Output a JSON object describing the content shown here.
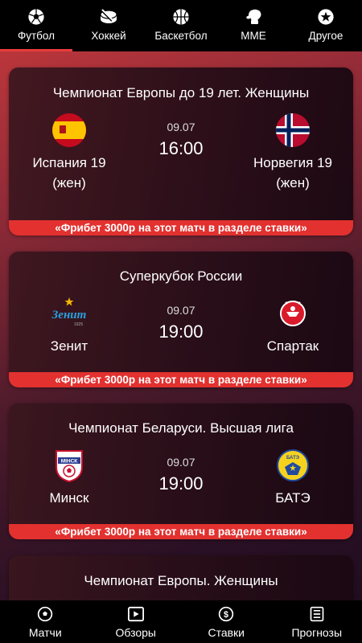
{
  "top_tabs": [
    {
      "label": "Футбол",
      "icon": "soccer-ball-icon",
      "active": true
    },
    {
      "label": "Хоккей",
      "icon": "hockey-puck-icon",
      "active": false
    },
    {
      "label": "Баскетбол",
      "icon": "basketball-icon",
      "active": false
    },
    {
      "label": "MME",
      "icon": "boxing-glove-icon",
      "active": false
    },
    {
      "label": "Другое",
      "icon": "star-icon",
      "active": false
    }
  ],
  "matches": [
    {
      "tournament": "Чемпионат Европы до 19 лет. Женщины",
      "home": {
        "name": "Испания 19",
        "sub": "(жен)",
        "logo": "spain-flag-icon"
      },
      "away": {
        "name": "Норвегия 19",
        "sub": "(жен)",
        "logo": "norway-flag-icon"
      },
      "date": "09.07",
      "time": "16:00",
      "promo": "«Фрибет 3000р на этот матч в разделе ставки»"
    },
    {
      "tournament": "Суперкубок России",
      "home": {
        "name": "Зенит",
        "logo": "zenit-logo-icon"
      },
      "away": {
        "name": "Спартак",
        "logo": "spartak-logo-icon"
      },
      "date": "09.07",
      "time": "19:00",
      "promo": "«Фрибет 3000р на этот матч в разделе ставки»"
    },
    {
      "tournament": "Чемпионат Беларуси. Высшая лига",
      "home": {
        "name": "Минск",
        "logo": "minsk-logo-icon"
      },
      "away": {
        "name": "БАТЭ",
        "logo": "bate-logo-icon"
      },
      "date": "09.07",
      "time": "19:00",
      "promo": "«Фрибет 3000р на этот матч в разделе ставки»"
    },
    {
      "tournament": "Чемпионат Европы. Женщины"
    }
  ],
  "bottom_tabs": [
    {
      "label": "Матчи",
      "icon": "soccer-ball-icon"
    },
    {
      "label": "Обзоры",
      "icon": "play-video-icon"
    },
    {
      "label": "Ставки",
      "icon": "dollar-coin-icon"
    },
    {
      "label": "Прогнозы",
      "icon": "list-icon"
    }
  ],
  "colors": {
    "accent": "#e83b3b",
    "promo_bg": "#e2312f",
    "nav_bg": "#000000"
  }
}
